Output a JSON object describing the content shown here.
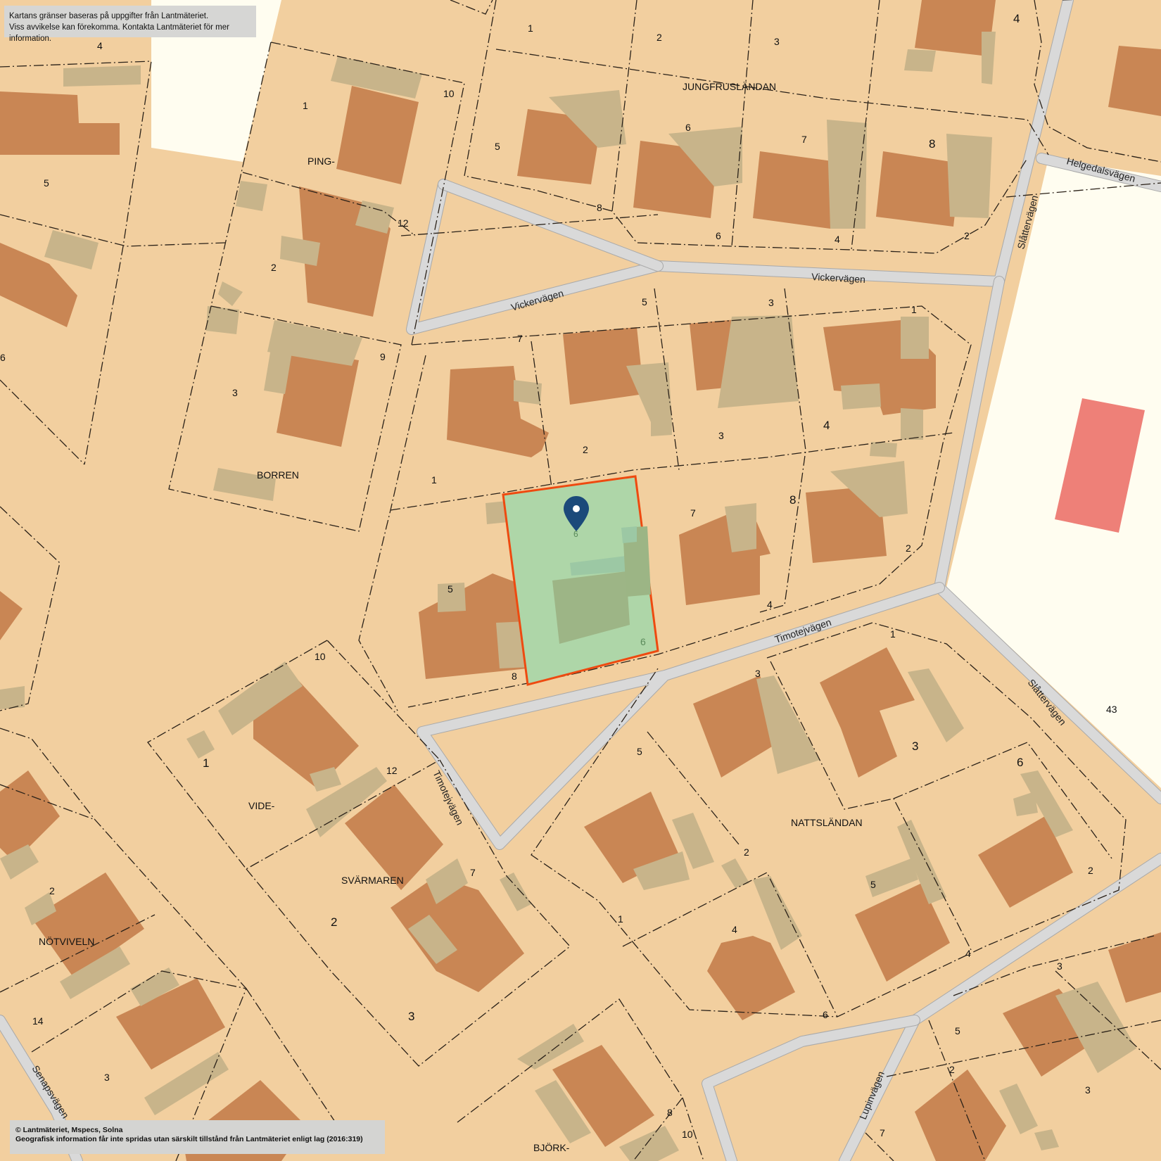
{
  "disclaimer": {
    "line1": "Kartans gränser baseras på uppgifter från Lantmäteriet.",
    "line2": "Viss avvikelse kan förekomma. Kontakta Lantmäteriet för mer information."
  },
  "copyright": {
    "line1": "© Lantmäteriet, Mspecs, Solna",
    "line2": "Geografisk information får inte spridas utan särskilt tillstånd från Lantmäteriet enligt lag (2016:319)"
  },
  "colors": {
    "land": "#f2cf9f",
    "open_area": "#fffdf0",
    "house": "#c98654",
    "annex": "#c8b48a",
    "road": "#d9d9d9",
    "selected_fill": "#aed6a8",
    "selected_border": "#ee4a10",
    "marker": "#1b4a7a",
    "red_building": "#ee8078"
  },
  "marker": {
    "icon": "map-pin-icon",
    "label": "6"
  },
  "selected_property": {
    "number_label": "6"
  },
  "streets": {
    "vickervagen_1": "Vickervägen",
    "vickervagen_2": "Vickervägen",
    "slattervagen_1": "Slåttervägen",
    "slattervagen_2": "Slåttervägen",
    "helgedalsvagen": "Helgedalsvägen",
    "timotejvagen_1": "Timotejvägen",
    "timotejvagen_2": "Timotejvägen",
    "senapsvagen": "Senapsvägen",
    "lupinvagen": "Lupinvägen"
  },
  "blocks": {
    "jungfruslandan": "JUNGFRUSLÄNDAN",
    "ping": "PING-",
    "borren": "BORREN",
    "vide": "VIDE-",
    "svarmaren": "SVÄRMAREN",
    "nattslandan": "NATTSLÄNDAN",
    "notviveln": "NÖTVIVELN",
    "bjork": "BJÖRK-"
  },
  "plot_numbers": {
    "n4_top": "4",
    "n5_left": "5",
    "n6_left": "6",
    "n1_ping": "1",
    "n10_ping": "10",
    "n12_ping": "12",
    "n2_ping": "2",
    "n9_borren": "9",
    "n3_borren": "3",
    "n1_top": "1",
    "n2_top": "2",
    "n3_top": "3",
    "n4_topright": "4",
    "n5_jung": "5",
    "n6_jung": "6",
    "n7_jung": "7",
    "n8_jung": "8",
    "n8_jung_b": "8",
    "n6_jung_b": "6",
    "n4_jung_b": "4",
    "n2_jung_b": "2",
    "n7_mid": "7",
    "n5_mid": "5",
    "n3_mid": "3",
    "n1_mid": "1",
    "n1_mid_b": "1",
    "n2_mid_b": "2",
    "n3_mid_b": "3",
    "n4_mid_b": "4",
    "n7_low": "7",
    "n8_low": "8",
    "n2_low": "2",
    "n4_low": "4",
    "n5_sel": "5",
    "n8_sel": "8",
    "n10_vide": "10",
    "n1_vide": "1",
    "n12_svar": "12",
    "n2_svar": "2",
    "n7_svar": "7",
    "n3_svar": "3",
    "n1_natt": "1",
    "n3_natt": "3",
    "n3_natt_b": "3",
    "n5_natt": "5",
    "n6_natt": "6",
    "n2_natt": "2",
    "n1_natt_b": "1",
    "n5_natt_b": "5",
    "n2_natt_b": "2",
    "n4_natt": "4",
    "n4_natt_b": "4",
    "n6_natt_b": "6",
    "n43": "43",
    "n2_notv": "2",
    "n14_notv": "14",
    "n3_notv": "3",
    "n8_bjork": "8",
    "n10_bjork": "10",
    "n3_br": "3",
    "n5_br": "5",
    "n2_br": "2",
    "n3_br_b": "3",
    "n7_br": "7"
  }
}
